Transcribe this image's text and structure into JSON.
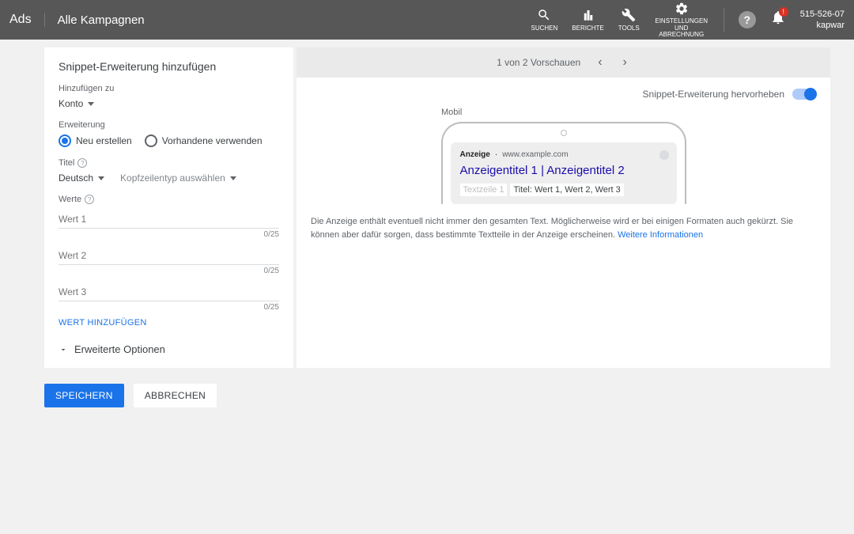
{
  "header": {
    "logo": "Ads",
    "title": "Alle Kampagnen",
    "tools": {
      "search": "SUCHEN",
      "reports": "BERICHTE",
      "tools": "TOOLS",
      "settings": "EINSTELLUNGEN UND ABRECHNUNG"
    },
    "account_id": "515-526-07",
    "account_name": "kapwar"
  },
  "form": {
    "title": "Snippet-Erweiterung hinzufügen",
    "add_to_label": "Hinzufügen zu",
    "add_to_value": "Konto",
    "extension_label": "Erweiterung",
    "radio_new": "Neu erstellen",
    "radio_existing": "Vorhandene verwenden",
    "title_label": "Titel",
    "language": "Deutsch",
    "header_type": "Kopfzeilentyp auswählen",
    "values_label": "Werte",
    "values": [
      {
        "placeholder": "Wert 1",
        "counter": "0/25"
      },
      {
        "placeholder": "Wert 2",
        "counter": "0/25"
      },
      {
        "placeholder": "Wert 3",
        "counter": "0/25"
      }
    ],
    "add_value": "WERT HINZUFÜGEN",
    "advanced": "Erweiterte Optionen"
  },
  "preview": {
    "counter": "1 von 2 Vorschauen",
    "highlight_label": "Snippet-Erweiterung hervorheben",
    "mobile_label": "Mobil",
    "ad_tag": "Anzeige",
    "ad_url": "www.example.com",
    "ad_headline": "Anzeigentitel 1 | Anzeigentitel 2",
    "textline": "Textzeile 1",
    "snippet": "Titel: Wert 1, Wert 2, Wert 3",
    "disclaimer": "Die Anzeige enthält eventuell nicht immer den gesamten Text. Möglicherweise wird er bei einigen Formaten auch gekürzt. Sie können aber dafür sorgen, dass bestimmte Textteile in der Anzeige erscheinen. ",
    "more_info": "Weitere Informationen"
  },
  "actions": {
    "save": "SPEICHERN",
    "cancel": "ABBRECHEN"
  }
}
